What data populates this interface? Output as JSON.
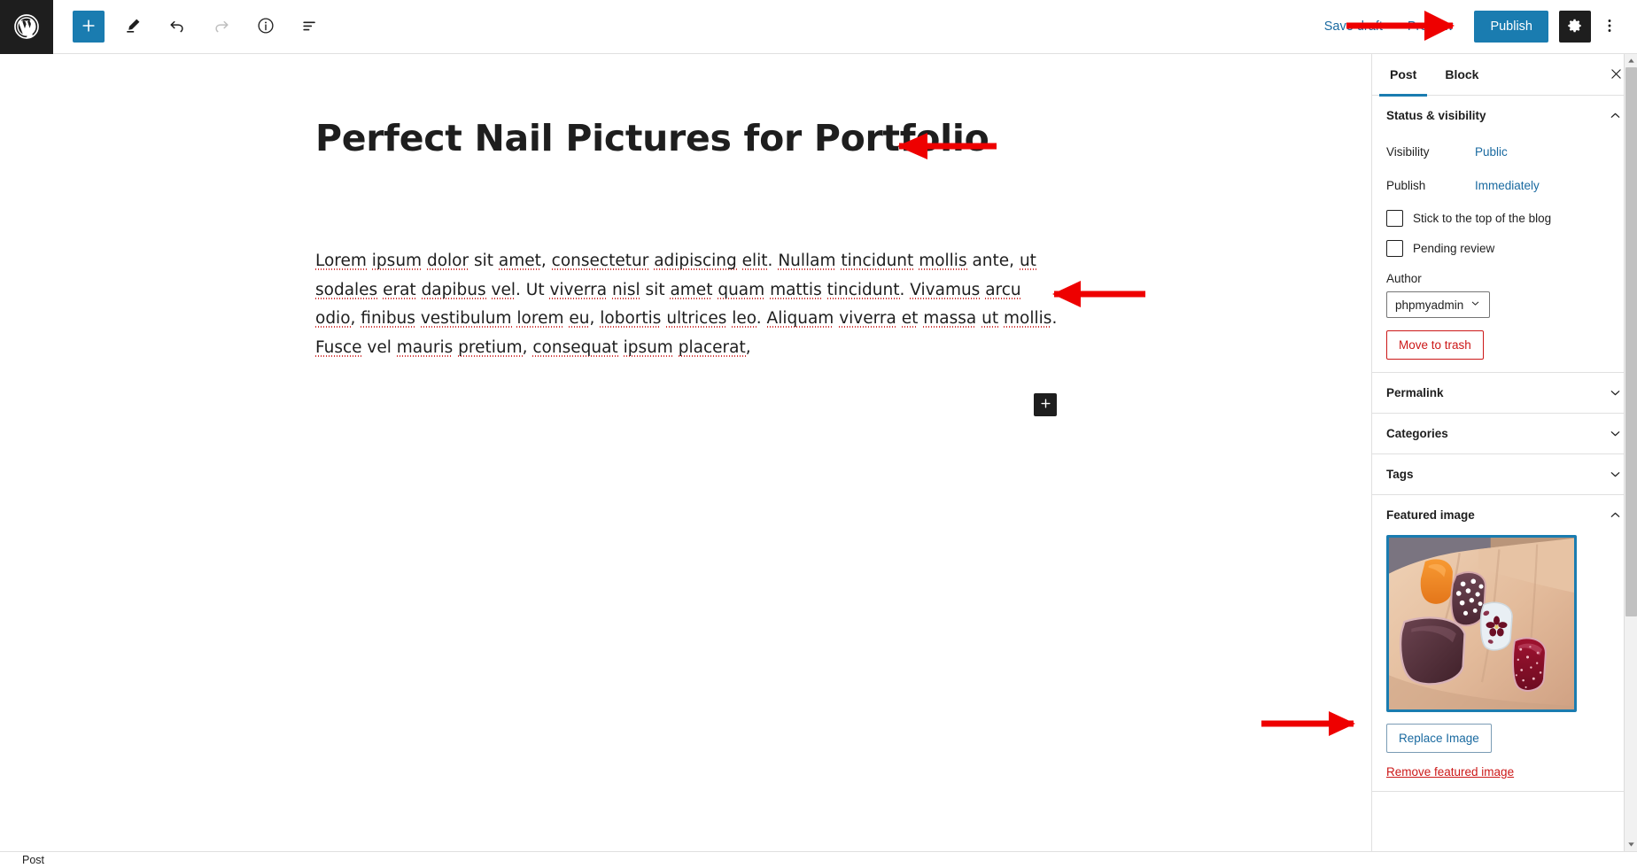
{
  "toolbar": {
    "wp_logo_label": "W",
    "inserter_label": "+",
    "tools_label": "Tools",
    "undo_label": "Undo",
    "redo_label": "Redo",
    "details_label": "Details",
    "list_view_label": "List view",
    "save_draft_label": "Save draft",
    "preview_label": "Preview",
    "publish_label": "Publish",
    "settings_label": "Settings",
    "options_label": "Options"
  },
  "editor": {
    "title": "Perfect Nail Pictures for Portfolio",
    "paragraph_runs": [
      {
        "t": "Lorem",
        "sp": true
      },
      {
        "t": " ",
        "sp": false
      },
      {
        "t": "ipsum",
        "sp": true
      },
      {
        "t": " ",
        "sp": false
      },
      {
        "t": "dolor",
        "sp": true
      },
      {
        "t": " sit ",
        "sp": false
      },
      {
        "t": "amet",
        "sp": true
      },
      {
        "t": ", ",
        "sp": false
      },
      {
        "t": "consectetur",
        "sp": true
      },
      {
        "t": " ",
        "sp": false
      },
      {
        "t": "adipiscing",
        "sp": true
      },
      {
        "t": " ",
        "sp": false
      },
      {
        "t": "elit",
        "sp": true
      },
      {
        "t": ". ",
        "sp": false
      },
      {
        "t": "Nullam",
        "sp": true
      },
      {
        "t": " ",
        "sp": false
      },
      {
        "t": "tincidunt",
        "sp": true
      },
      {
        "t": " ",
        "sp": false
      },
      {
        "t": "mollis",
        "sp": true
      },
      {
        "t": " ante, ",
        "sp": false
      },
      {
        "t": "ut",
        "sp": true
      },
      {
        "t": " ",
        "sp": false
      },
      {
        "t": "sodales",
        "sp": true
      },
      {
        "t": " ",
        "sp": false
      },
      {
        "t": "erat",
        "sp": true
      },
      {
        "t": " ",
        "sp": false
      },
      {
        "t": "dapibus",
        "sp": true
      },
      {
        "t": " ",
        "sp": false
      },
      {
        "t": "vel",
        "sp": true
      },
      {
        "t": ". Ut ",
        "sp": false
      },
      {
        "t": "viverra",
        "sp": true
      },
      {
        "t": " ",
        "sp": false
      },
      {
        "t": "nisl",
        "sp": true
      },
      {
        "t": " sit ",
        "sp": false
      },
      {
        "t": "amet",
        "sp": true
      },
      {
        "t": " ",
        "sp": false
      },
      {
        "t": "quam",
        "sp": true
      },
      {
        "t": " ",
        "sp": false
      },
      {
        "t": "mattis",
        "sp": true
      },
      {
        "t": " ",
        "sp": false
      },
      {
        "t": "tincidunt",
        "sp": true
      },
      {
        "t": ". ",
        "sp": false
      },
      {
        "t": "Vivamus",
        "sp": true
      },
      {
        "t": " ",
        "sp": false
      },
      {
        "t": "arcu",
        "sp": true
      },
      {
        "t": " ",
        "sp": false
      },
      {
        "t": "odio",
        "sp": true
      },
      {
        "t": ", ",
        "sp": false
      },
      {
        "t": "finibus",
        "sp": true
      },
      {
        "t": " ",
        "sp": false
      },
      {
        "t": "vestibulum",
        "sp": true
      },
      {
        "t": " ",
        "sp": false
      },
      {
        "t": "lorem",
        "sp": true
      },
      {
        "t": " ",
        "sp": false
      },
      {
        "t": "eu",
        "sp": true
      },
      {
        "t": ", ",
        "sp": false
      },
      {
        "t": "lobortis",
        "sp": true
      },
      {
        "t": " ",
        "sp": false
      },
      {
        "t": "ultrices",
        "sp": true
      },
      {
        "t": " ",
        "sp": false
      },
      {
        "t": "leo",
        "sp": true
      },
      {
        "t": ". ",
        "sp": false
      },
      {
        "t": "Aliquam",
        "sp": true
      },
      {
        "t": " ",
        "sp": false
      },
      {
        "t": "viverra",
        "sp": true
      },
      {
        "t": " ",
        "sp": false
      },
      {
        "t": "et",
        "sp": true
      },
      {
        "t": " ",
        "sp": false
      },
      {
        "t": "massa",
        "sp": true
      },
      {
        "t": " ",
        "sp": false
      },
      {
        "t": "ut",
        "sp": true
      },
      {
        "t": " ",
        "sp": false
      },
      {
        "t": "mollis",
        "sp": true
      },
      {
        "t": ". ",
        "sp": false
      },
      {
        "t": "Fusce",
        "sp": true
      },
      {
        "t": " vel ",
        "sp": false
      },
      {
        "t": "mauris",
        "sp": true
      },
      {
        "t": " ",
        "sp": false
      },
      {
        "t": "pretium",
        "sp": true
      },
      {
        "t": ", ",
        "sp": false
      },
      {
        "t": "consequat",
        "sp": true
      },
      {
        "t": " ",
        "sp": false
      },
      {
        "t": "ipsum",
        "sp": true
      },
      {
        "t": " ",
        "sp": false
      },
      {
        "t": "placerat",
        "sp": true
      },
      {
        "t": ",",
        "sp": false
      }
    ],
    "paragraph_plain": "Lorem ipsum dolor sit amet, consectetur adipiscing elit. Nullam tincidunt mollis ante, ut sodales erat dapibus vel. Ut viverra nisl sit amet quam mattis tincidunt. Vivamus arcu odio, finibus vestibulum lorem eu, lobortis ultrices leo. Aliquam viverra et massa ut mollis. Fusce vel mauris pretium, consequat ipsum placerat,",
    "block_inserter_label": "+"
  },
  "sidebar": {
    "tabs": [
      {
        "label": "Post",
        "active": true
      },
      {
        "label": "Block",
        "active": false
      }
    ],
    "close_label": "Close settings",
    "panels": [
      {
        "title": "Status & visibility",
        "expanded": true
      },
      {
        "title": "Permalink",
        "expanded": false
      },
      {
        "title": "Categories",
        "expanded": false
      },
      {
        "title": "Tags",
        "expanded": false
      },
      {
        "title": "Featured image",
        "expanded": true
      }
    ],
    "status": {
      "visibility_label": "Visibility",
      "visibility_value": "Public",
      "publish_label": "Publish",
      "publish_value": "Immediately",
      "sticky_label": "Stick to the top of the blog",
      "sticky_checked": false,
      "pending_label": "Pending review",
      "pending_checked": false,
      "author_label": "Author",
      "author_value": "phpmyadmin",
      "trash_label": "Move to trash"
    },
    "featured": {
      "replace_label": "Replace Image",
      "remove_label": "Remove featured image",
      "image_alt": "Hand with painted fingernails"
    }
  },
  "bottom": {
    "breadcrumb": "Post"
  },
  "colors": {
    "accent": "#1a7cb0",
    "link": "#1a6aa0",
    "danger": "#cc1818",
    "dark": "#1e1e1e",
    "annotation_arrow": "#ee0000",
    "spellcheck": "#d03a3a"
  },
  "annotations": [
    {
      "name": "arrow-to-title",
      "direction": "left"
    },
    {
      "name": "arrow-to-paragraph",
      "direction": "left"
    },
    {
      "name": "arrow-to-publish",
      "direction": "right"
    },
    {
      "name": "arrow-to-featured-image",
      "direction": "right"
    }
  ]
}
